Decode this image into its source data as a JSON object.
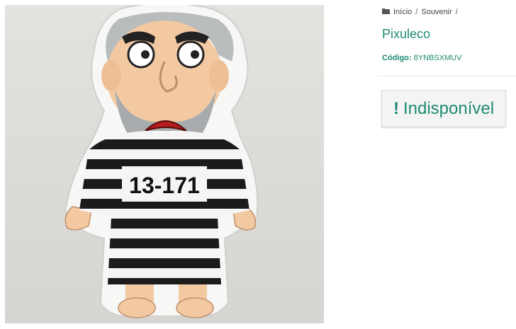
{
  "breadcrumb": {
    "home": "Início",
    "category": "Souvenir",
    "separator": "/"
  },
  "product": {
    "title": "Pixuleco",
    "code_label": "Código:",
    "code_value": "8YNBSXMUV",
    "status_icon": "exclamation-icon",
    "status_text": "Indisponível",
    "image_text": "13-171"
  },
  "colors": {
    "accent": "#1e8a72"
  }
}
